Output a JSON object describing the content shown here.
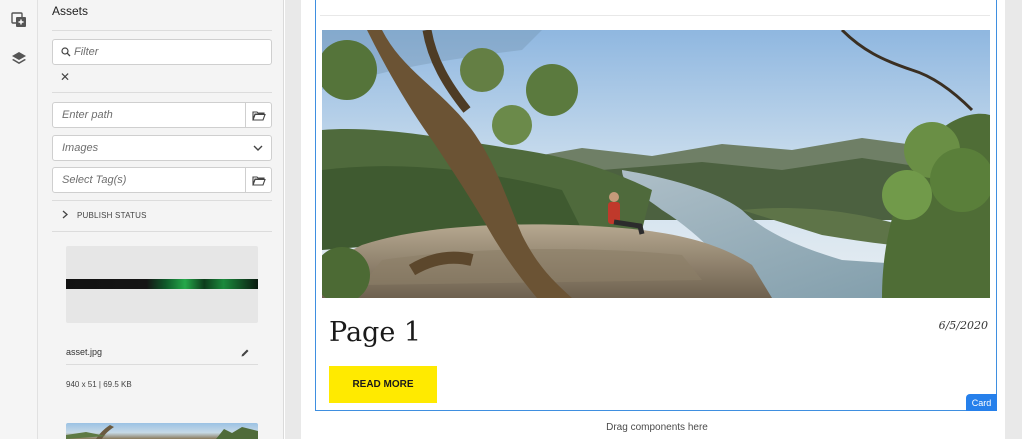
{
  "rail": {
    "icons": [
      "add-component-icon",
      "layers-icon"
    ]
  },
  "assets_panel": {
    "title": "Assets",
    "filter": {
      "placeholder": "Filter",
      "clear_symbol": "✕"
    },
    "path": {
      "placeholder": "Enter path"
    },
    "type_select": {
      "selected": "Images"
    },
    "tags": {
      "placeholder": "Select Tag(s)"
    },
    "publish_status_label": "PUBLISH STATUS",
    "asset": {
      "name": "asset.jpg",
      "meta": "940 x 51 | 69.5 KB"
    }
  },
  "card": {
    "title": "Page 1",
    "date": "6/5/2020",
    "button_label": "READ MORE",
    "badge": "Card"
  },
  "canvas": {
    "drop_hint": "Drag components here"
  },
  "colors": {
    "accent_blue": "#2680eb",
    "button_yellow": "#ffea00"
  }
}
